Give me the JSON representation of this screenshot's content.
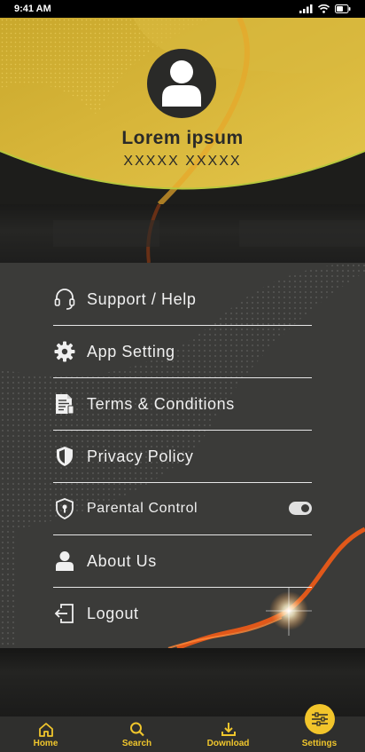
{
  "status_bar": {
    "time": "9:41 AM"
  },
  "profile": {
    "name": "Lorem ipsum",
    "subtitle": "XXXXX XXXXX",
    "avatar_icon": "user-icon"
  },
  "menu": {
    "items": [
      {
        "label": "Support / Help",
        "icon": "headset-icon"
      },
      {
        "label": "App Setting",
        "icon": "gear-icon"
      },
      {
        "label": "Terms & Conditions",
        "icon": "document-icon"
      },
      {
        "label": "Privacy Policy",
        "icon": "shield-icon"
      },
      {
        "label": "Parental Control",
        "icon": "shield-lock-icon",
        "toggle_on": true
      },
      {
        "label": "About Us",
        "icon": "person-icon"
      },
      {
        "label": "Logout",
        "icon": "logout-icon"
      }
    ]
  },
  "nav": {
    "items": [
      {
        "label": "Home",
        "icon": "home-icon"
      },
      {
        "label": "Search",
        "icon": "search-icon"
      },
      {
        "label": "Download",
        "icon": "download-icon"
      },
      {
        "label": "Settings",
        "icon": "sliders-icon",
        "active": true
      }
    ]
  },
  "colors": {
    "accent": "#f2c52b",
    "panel": "#3b3b39",
    "background": "#1d1d1b",
    "wave": "#e0581a"
  }
}
